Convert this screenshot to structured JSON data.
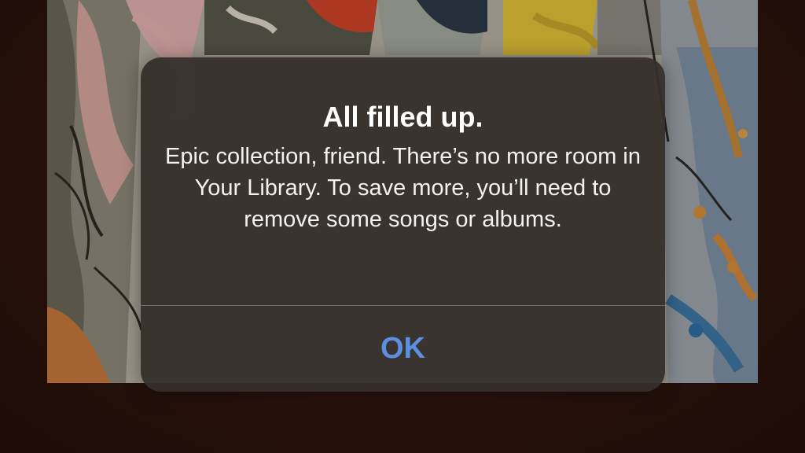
{
  "alert": {
    "title": "All filled up.",
    "message": "Epic collection, friend. There’s no more room in Your Library. To save more, you’ll need to remove some songs or albums.",
    "ok_label": "OK"
  },
  "colors": {
    "background": "#2a0f0a",
    "alert_background": "#342e2c",
    "button_text": "#5b8fe0",
    "title_text": "#ffffff"
  },
  "background_image": "album-artwork-painting"
}
